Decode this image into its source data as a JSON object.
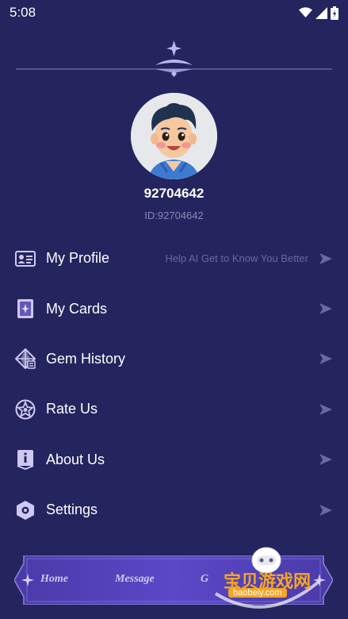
{
  "status_bar": {
    "time": "5:08"
  },
  "profile": {
    "username": "92704642",
    "user_id": "ID:92704642"
  },
  "menu": [
    {
      "label": "My Profile",
      "hint": "Help AI Get to Know You Better",
      "icon": "id-card-icon"
    },
    {
      "label": "My Cards",
      "icon": "card-icon"
    },
    {
      "label": "Gem History",
      "icon": "gem-icon"
    },
    {
      "label": "Rate Us",
      "icon": "star-icon"
    },
    {
      "label": "About Us",
      "icon": "info-icon"
    },
    {
      "label": "Settings",
      "icon": "settings-icon"
    }
  ],
  "bottom_nav": {
    "home": "Home",
    "message": "Message",
    "third": "G"
  },
  "watermark": {
    "text": "宝贝游戏网",
    "url": "baobeiy.com"
  },
  "colors": {
    "background": "#24245e",
    "accent": "#a99fe0",
    "nav_bg": "#5a48c8"
  }
}
